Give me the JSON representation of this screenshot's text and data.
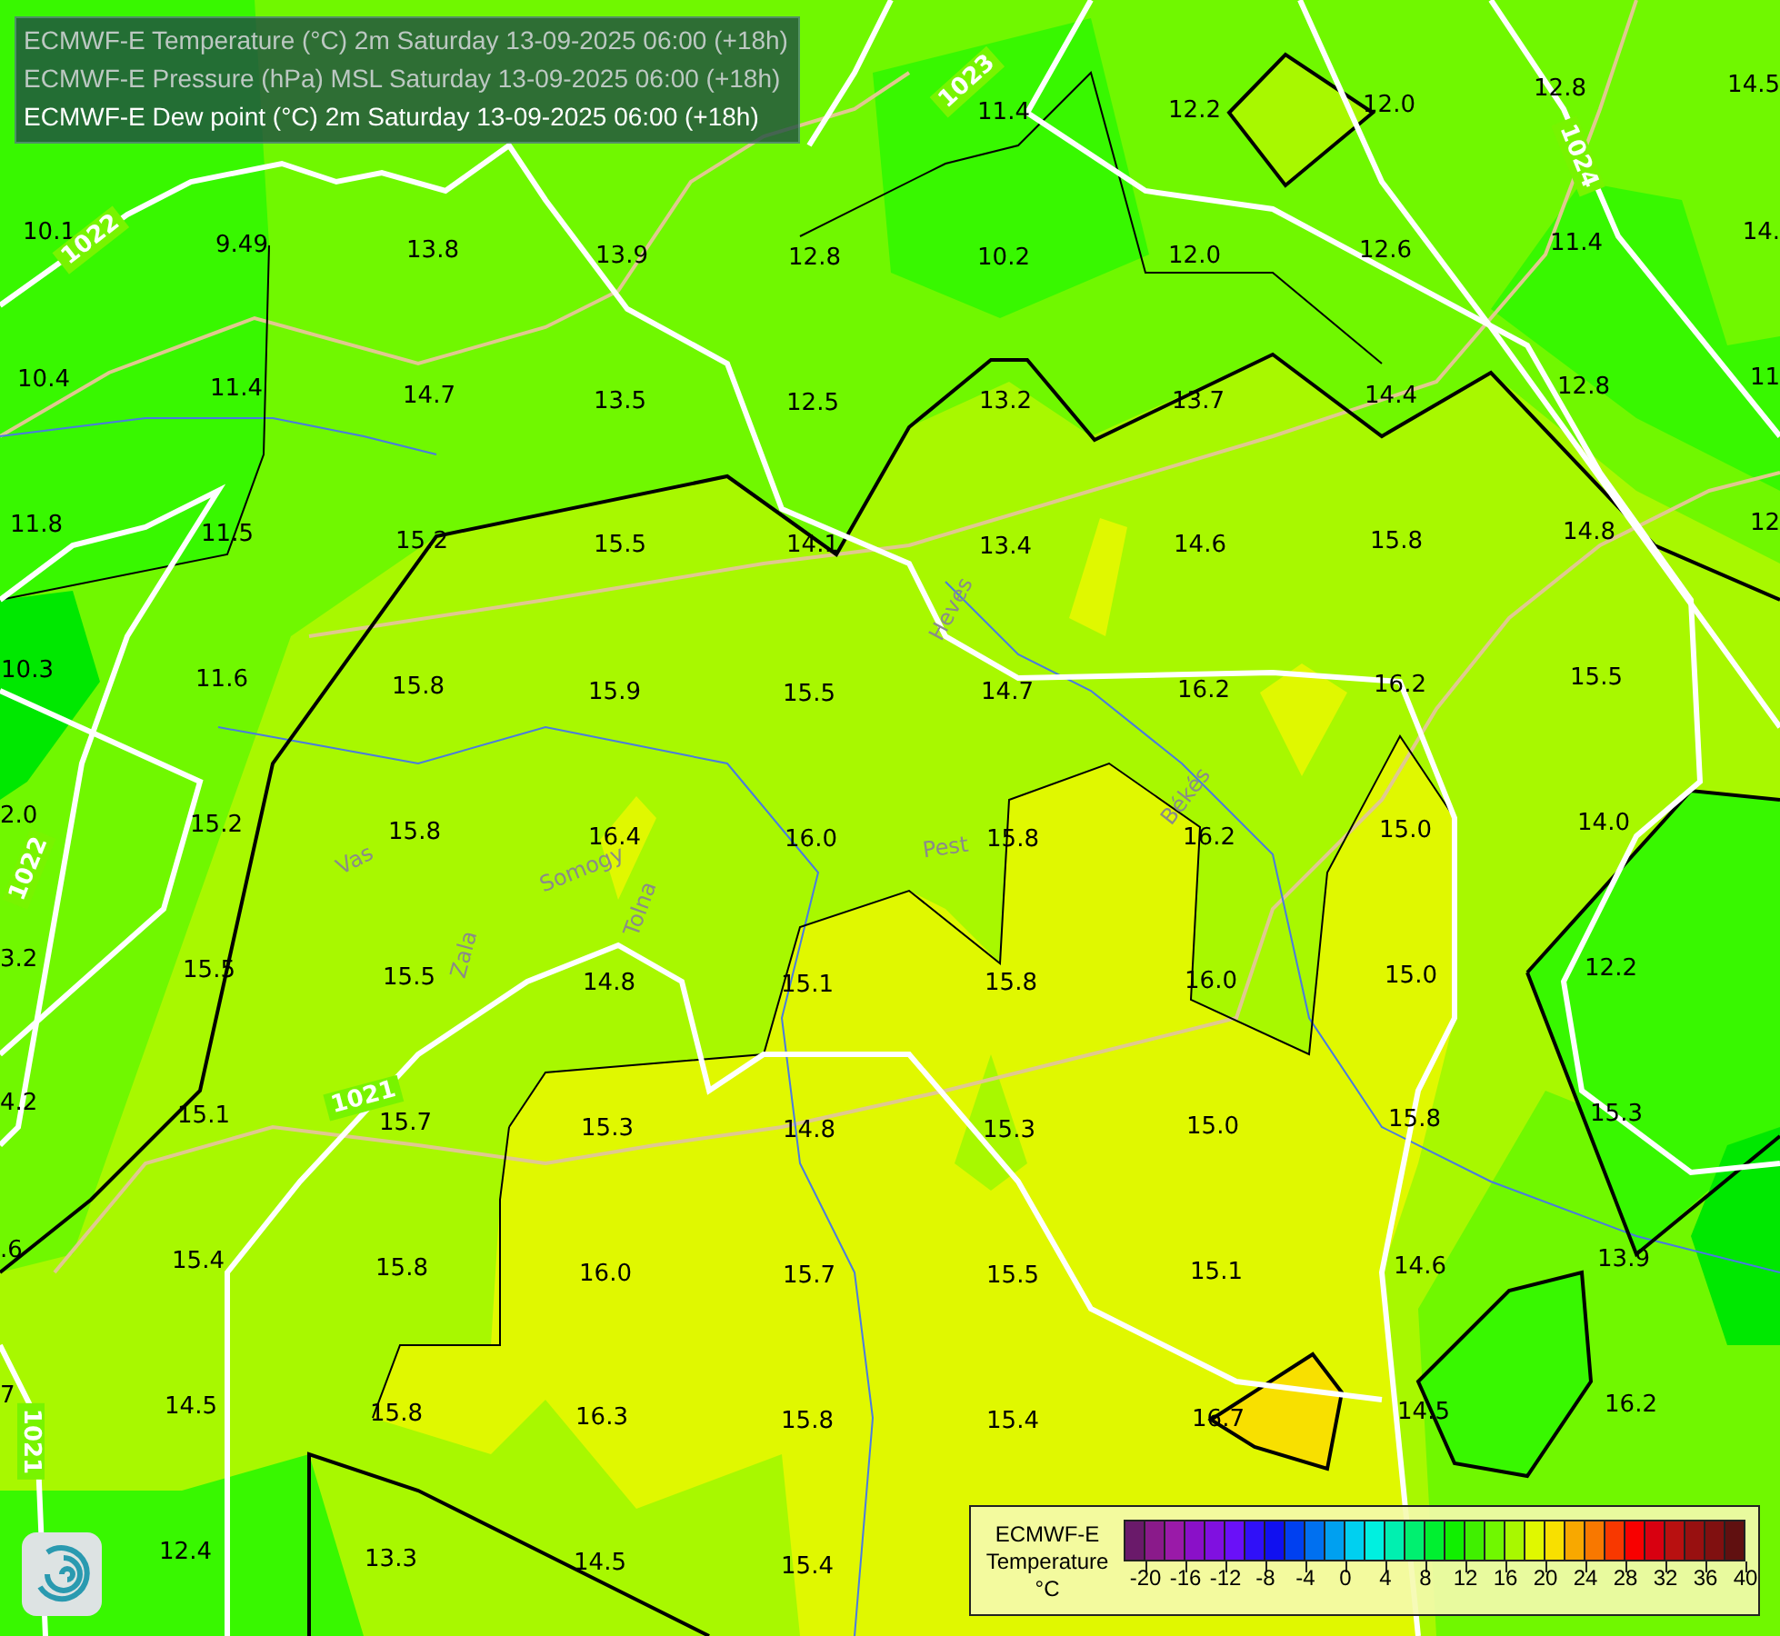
{
  "header": {
    "lines": [
      {
        "text": "ECMWF-E Temperature (°C) 2m Saturday 13-09-2025 06:00 (+18h)",
        "active": false
      },
      {
        "text": "ECMWF-E Pressure (hPa) MSL Saturday 13-09-2025 06:00 (+18h)",
        "active": false
      },
      {
        "text": "ECMWF-E Dew point (°C) 2m Saturday 13-09-2025 06:00 (+18h)",
        "active": true
      }
    ]
  },
  "map": {
    "temperature_labels": [
      "11.4",
      "12.2",
      "12.0",
      "12.8",
      "14.5",
      "10.1",
      "9.49",
      "13.8",
      "13.9",
      "12.8",
      "10.2",
      "12.0",
      "12.6",
      "11.4",
      "14.",
      "10.4",
      "11.4",
      "14.7",
      "13.5",
      "12.5",
      "13.2",
      "13.7",
      "14.4",
      "12.8",
      "11",
      "11.8",
      "11.5",
      "15.2",
      "15.5",
      "14.1",
      "13.4",
      "14.6",
      "15.8",
      "14.8",
      "12",
      "10.3",
      "11.6",
      "15.8",
      "15.9",
      "15.5",
      "14.7",
      "16.2",
      "16.2",
      "15.5",
      "2.0",
      "15.2",
      "15.8",
      "16.4",
      "16.0",
      "15.8",
      "16.2",
      "15.0",
      "14.0",
      "3.2",
      "15.5",
      "15.5",
      "14.8",
      "15.1",
      "15.8",
      "16.0",
      "15.0",
      "12.2",
      "4.2",
      "15.1",
      "15.7",
      "15.3",
      "14.8",
      "15.3",
      "15.0",
      "15.8",
      "15.3",
      ".6",
      "15.4",
      "15.8",
      "16.0",
      "15.7",
      "15.5",
      "15.1",
      "14.6",
      "13.9",
      "7",
      "14.5",
      "15.8",
      "16.3",
      "15.8",
      "15.4",
      "16.7",
      "14.5",
      "16.2",
      "12.4",
      "13.3",
      "14.5",
      "15.4"
    ],
    "isobar_labels": [
      "1022",
      "1023",
      "1024",
      "1022",
      "1021",
      "1021"
    ],
    "region_labels": [
      "Heves",
      "Vas",
      "Somogy",
      "Zala",
      "Tolna",
      "Pest",
      "Békés"
    ]
  },
  "legend": {
    "title": "ECMWF-E",
    "quantity": "Temperature",
    "unit": "°C",
    "swatches": [
      {
        "color": "#6a1a6a"
      },
      {
        "color": "#8a1a8a"
      },
      {
        "color": "#9a1aa8"
      },
      {
        "color": "#8a10c8"
      },
      {
        "color": "#8010e0"
      },
      {
        "color": "#6a10f8"
      },
      {
        "color": "#3010f8"
      },
      {
        "color": "#1010f0"
      },
      {
        "color": "#0040f0"
      },
      {
        "color": "#0070f0"
      },
      {
        "color": "#00a0f0"
      },
      {
        "color": "#00d0f0"
      },
      {
        "color": "#00f0e0"
      },
      {
        "color": "#00f0b0"
      },
      {
        "color": "#00f070"
      },
      {
        "color": "#00f030"
      },
      {
        "color": "#10f000"
      },
      {
        "color": "#40f000"
      },
      {
        "color": "#70f800"
      },
      {
        "color": "#a8f800"
      },
      {
        "color": "#e0f800"
      },
      {
        "color": "#f8e000"
      },
      {
        "color": "#f8a800"
      },
      {
        "color": "#f87800"
      },
      {
        "color": "#f83800"
      },
      {
        "color": "#f80000"
      },
      {
        "color": "#d80010"
      },
      {
        "color": "#b81010"
      },
      {
        "color": "#981010"
      },
      {
        "color": "#801010"
      },
      {
        "color": "#601010"
      }
    ],
    "ticks": [
      "-20",
      "-16",
      "-12",
      "-8",
      "-4",
      "0",
      "4",
      "8",
      "12",
      "16",
      "20",
      "24",
      "28",
      "32",
      "36",
      "40"
    ]
  }
}
